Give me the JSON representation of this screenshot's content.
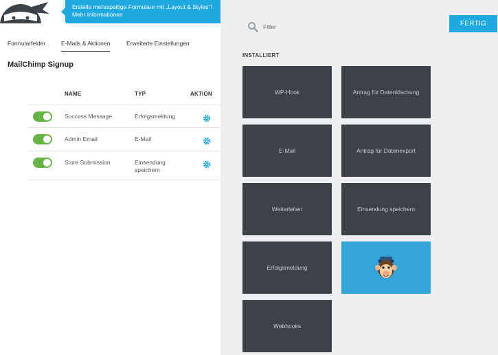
{
  "banner": {
    "line1": "Erstelle mehrspaltige Formulare mit „Layout & Styles“!",
    "line2": "Mehr Informationen"
  },
  "tabs": [
    {
      "label": "Formularfelder",
      "active": false
    },
    {
      "label": "E-Mails & Aktionen",
      "active": true
    },
    {
      "label": "Erweiterte Einstellungen",
      "active": false
    }
  ],
  "form": {
    "title": "MailChimp Signup"
  },
  "table": {
    "headers": {
      "name": "NAME",
      "type": "TYP",
      "action": "AKTION"
    },
    "rows": [
      {
        "name": "Success Message",
        "type": "Erfolgsmeldung",
        "enabled": true
      },
      {
        "name": "Admin Email",
        "type": "E-Mail",
        "enabled": true
      },
      {
        "name": "Store Submission",
        "type": "Einsendung speichern",
        "enabled": true
      }
    ]
  },
  "filter": {
    "placeholder": "Filter"
  },
  "done_button": {
    "label": "FERTIG"
  },
  "installed": {
    "label": "INSTALLIERT",
    "tiles": [
      "WP-Hook",
      "Antrag für Datenlöschung",
      "E-Mail",
      "Antrag für Datenexport",
      "Weiterleiten",
      "Einsendung speichern",
      "Erfolgsmeldung",
      "",
      "Webhooks"
    ]
  },
  "colors": {
    "accent": "#1ea9e1",
    "toggle_on": "#67b345",
    "tile_bg": "#3c4248",
    "mailchimp_tile": "#35a4d8",
    "right_panel_bg": "#edeff1"
  },
  "icons": {
    "logo": "ninja-logo-icon",
    "filter": "search-icon",
    "action": "gear-icon",
    "mailchimp": "mailchimp-freddie-icon"
  }
}
